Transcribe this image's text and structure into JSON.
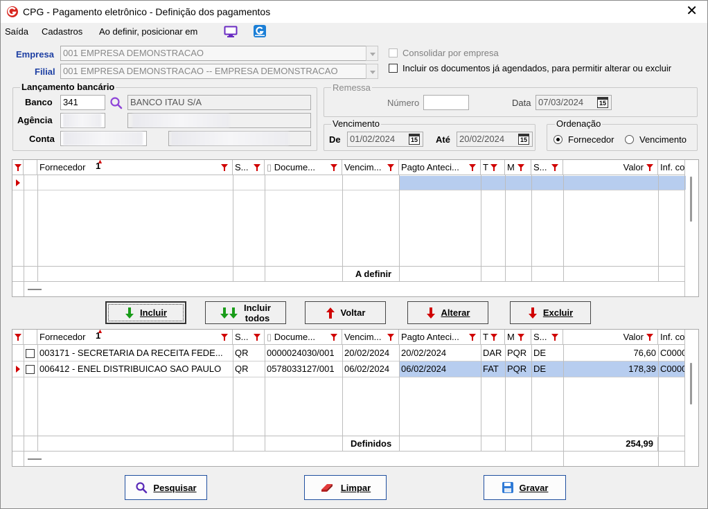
{
  "window": {
    "title": "CPG - Pagamento eletrônico - Definição dos pagamentos",
    "close_glyph": "✕"
  },
  "menu": {
    "items": [
      "Saída",
      "Cadastros",
      "Ao definir, posicionar em"
    ]
  },
  "empresa": {
    "label": "Empresa",
    "value": "001 EMPRESA DEMONSTRACAO",
    "consolidar_label": "Consolidar por empresa"
  },
  "filial": {
    "label": "Filial",
    "value": "001 EMPRESA DEMONSTRACAO -- EMPRESA DEMONSTRACAO",
    "incluir_label": "Incluir os documentos já agendados, para permitir alterar ou excluir"
  },
  "lancamento": {
    "title": "Lançamento bancário",
    "banco_label": "Banco",
    "banco_code": "341",
    "banco_name": "BANCO ITAU S/A",
    "agencia_label": "Agência",
    "conta_label": "Conta"
  },
  "remessa": {
    "title": "Remessa",
    "numero_label": "Número",
    "numero_value": "",
    "data_label": "Data",
    "data_value": "07/03/2024"
  },
  "vencimento": {
    "title": "Vencimento",
    "de_label": "De",
    "de_value": "01/02/2024",
    "ate_label": "Até",
    "ate_value": "20/02/2024"
  },
  "ordenacao": {
    "title": "Ordenação",
    "options": [
      "Fornecedor",
      "Vencimento"
    ],
    "selected": "Fornecedor"
  },
  "calendar_glyph": "15",
  "columns": [
    "Fornecedor",
    "S...",
    "Docume...",
    "Vencim...",
    "Pagto Anteci...",
    "T",
    "M",
    "S...",
    "Valor",
    "Inf. co"
  ],
  "sort_marker": "1",
  "top_grid": {
    "footer_label": "A definir"
  },
  "actions": {
    "incluir": "Incluir",
    "incluir_todos_1": "Incluir",
    "incluir_todos_2": "todos",
    "voltar": "Voltar",
    "alterar": "Alterar",
    "excluir": "Excluir"
  },
  "bottom_grid": {
    "rows": [
      {
        "fornecedor": "003171 - SECRETARIA DA RECEITA FEDE...",
        "s": "QR",
        "documento": "0000024030/001",
        "vencimento": "20/02/2024",
        "pagto": "20/02/2024",
        "t": "DAR",
        "m": "PQR",
        "s2": "DE",
        "valor": "76,60",
        "inf": "C0000"
      },
      {
        "fornecedor": "006412 - ENEL DISTRIBUICAO SAO PAULO",
        "s": "QR",
        "documento": "0578033127/001",
        "vencimento": "06/02/2024",
        "pagto": "06/02/2024",
        "t": "FAT",
        "m": "PQR",
        "s2": "DE",
        "valor": "178,39",
        "inf": "C0000"
      }
    ],
    "footer_label": "Definidos",
    "footer_total": "254,99"
  },
  "bottom_buttons": {
    "pesquisar": "Pesquisar",
    "limpar": "Limpar",
    "gravar": "Gravar"
  },
  "colors": {
    "accent_blue": "#1d3fa3",
    "selection": "#b7cdef",
    "filter_red": "#d00000",
    "arrow_green": "#1a9c1a"
  }
}
